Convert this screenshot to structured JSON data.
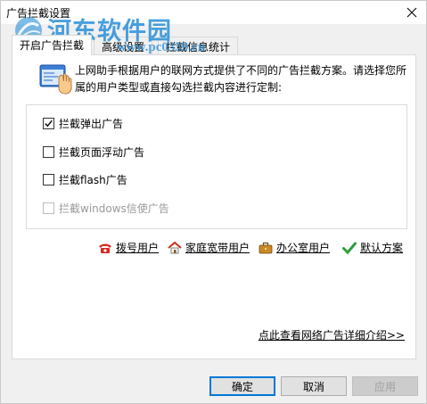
{
  "window": {
    "title": "广告拦截设置"
  },
  "watermark": {
    "site_name": "河东软件园",
    "url": "www.pc0359.cn"
  },
  "tabs": [
    {
      "label": "开启广告拦截",
      "active": true
    },
    {
      "label": "高级设置",
      "active": false
    },
    {
      "label": "拦截信息统计",
      "active": false
    }
  ],
  "panel": {
    "description": "上网助手根据用户的联网方式提供了不同的广告拦截方案。请选择您所属的用户类型或直接勾选拦截内容进行定制:",
    "options": [
      {
        "label": "拦截弹出广告",
        "checked": true,
        "enabled": true
      },
      {
        "label": "拦截页面浮动广告",
        "checked": false,
        "enabled": true
      },
      {
        "label": "拦截flash广告",
        "checked": false,
        "enabled": true
      },
      {
        "label": "拦截windows信使广告",
        "checked": false,
        "enabled": false
      }
    ],
    "presets": [
      {
        "label": "拨号用户",
        "icon": "telephone-icon"
      },
      {
        "label": "家庭宽带用户",
        "icon": "house-icon"
      },
      {
        "label": "办公室用户",
        "icon": "briefcase-icon"
      },
      {
        "label": "默认方案",
        "icon": "checkmark-icon"
      }
    ],
    "detail_link": "点此查看网络广告详细介绍>>"
  },
  "buttons": {
    "ok": "确定",
    "cancel": "取消",
    "apply": "应用"
  },
  "colors": {
    "default_button_border": "#0078d7",
    "watermark": "#2a8fd8"
  }
}
